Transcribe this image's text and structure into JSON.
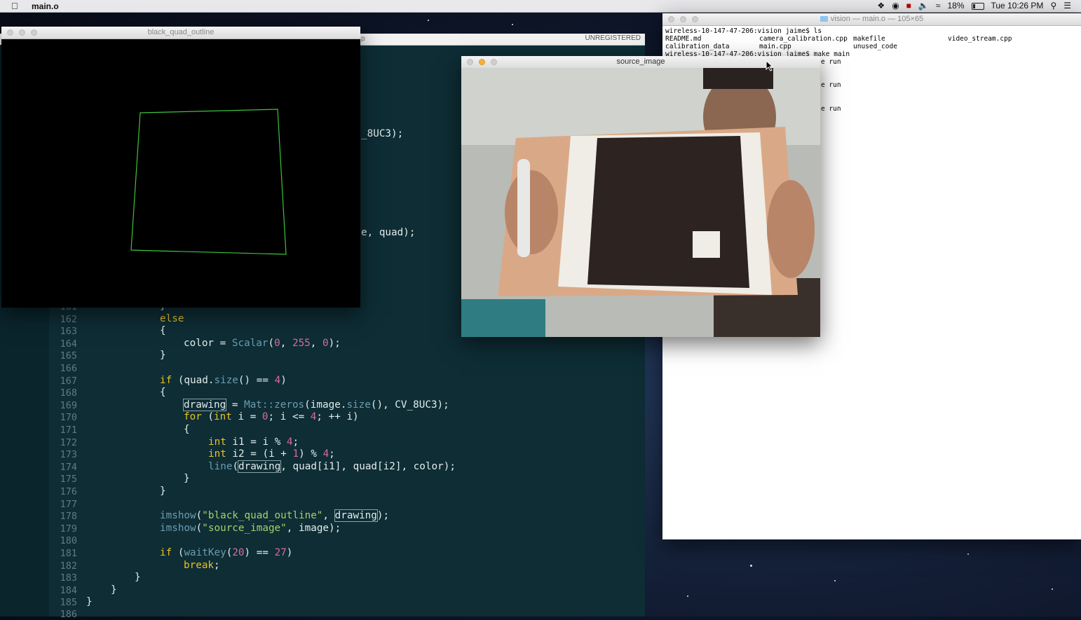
{
  "menubar": {
    "app_name": "main.o",
    "battery": "18%",
    "clock": "Tue 10:26 PM"
  },
  "editor": {
    "unregistered": "UNREGISTERED",
    "tab_fragment": "p",
    "partial_lines": {
      "line_a": "_8UC3);",
      "line_b": "e, quad);",
      "line_161": "161"
    },
    "lines": [
      {
        "n": "162"
      },
      {
        "n": "163"
      },
      {
        "n": "164"
      },
      {
        "n": "165"
      },
      {
        "n": "166"
      },
      {
        "n": "167"
      },
      {
        "n": "168"
      },
      {
        "n": "169"
      },
      {
        "n": "170"
      },
      {
        "n": "171"
      },
      {
        "n": "172"
      },
      {
        "n": "173"
      },
      {
        "n": "174"
      },
      {
        "n": "175"
      },
      {
        "n": "176"
      },
      {
        "n": "177"
      },
      {
        "n": "178"
      },
      {
        "n": "179"
      },
      {
        "n": "180"
      },
      {
        "n": "181"
      },
      {
        "n": "182"
      },
      {
        "n": "183"
      },
      {
        "n": "184"
      },
      {
        "n": "185"
      },
      {
        "n": "186"
      }
    ],
    "code": {
      "c161": "}",
      "c162": "else",
      "c163": "{",
      "c164_a": "color = ",
      "c164_fn": "Scalar",
      "c164_b": "(",
      "c164_n1": "0",
      "c164_c": ", ",
      "c164_n2": "255",
      "c164_d": ", ",
      "c164_n3": "0",
      "c164_e": ");",
      "c165": "}",
      "c167_kw": "if",
      "c167_a": " (quad.",
      "c167_fn": "size",
      "c167_b": "() == ",
      "c167_n": "4",
      "c167_c": ")",
      "c168": "{",
      "c169_box": "drawing",
      "c169_a": " = ",
      "c169_fn": "Mat::zeros",
      "c169_b": "(image.",
      "c169_fn2": "size",
      "c169_c": "(), CV_8UC3);",
      "c170_kw": "for",
      "c170_a": " (",
      "c170_kw2": "int",
      "c170_b": " i = ",
      "c170_n": "0",
      "c170_c": "; i <= ",
      "c170_n2": "4",
      "c170_d": "; ++ i)",
      "c171": "{",
      "c172_kw": "int",
      "c172_a": " i1 = i % ",
      "c172_n": "4",
      "c172_b": ";",
      "c173_kw": "int",
      "c173_a": " i2 = (i + ",
      "c173_n": "1",
      "c173_b": ") % ",
      "c173_n2": "4",
      "c173_c": ";",
      "c174_fn": "line",
      "c174_a": "(",
      "c174_box": "drawing",
      "c174_b": ", quad[i1], quad[i2], color);",
      "c175": "}",
      "c176": "}",
      "c178_fn": "imshow",
      "c178_a": "(",
      "c178_s": "\"black_quad_outline\"",
      "c178_b": ", ",
      "c178_box": "drawing",
      "c178_c": ");",
      "c179_fn": "imshow",
      "c179_a": "(",
      "c179_s": "\"source_image\"",
      "c179_b": ", image);",
      "c181_kw": "if",
      "c181_a": " (",
      "c181_fn": "waitKey",
      "c181_b": "(",
      "c181_n": "20",
      "c181_c": ") == ",
      "c181_n2": "27",
      "c181_d": ")",
      "c182_kw": "break",
      "c182_a": ";",
      "c183": "}",
      "c184": "}",
      "c185": "}"
    }
  },
  "quad_window": {
    "title": "black_quad_outline",
    "outline_color": "#3cc43c"
  },
  "source_window": {
    "title": "source_image"
  },
  "terminal": {
    "title": "vision — main.o — 105×65",
    "lines": {
      "l1": "wireless-10-147-47-206:vision jaime$ ls",
      "l2a": "README.md",
      "l2b": "camera_calibration.cpp",
      "l2c": "makefile",
      "l2d": "video_stream.cpp",
      "l3a": "calibration_data",
      "l3b": "main.cpp",
      "l3c": "unused_code",
      "l4": "wireless-10-147-47-206:vision jaime$ make main",
      "run1": "e run",
      "run2": "e run",
      "run3": "e run"
    }
  }
}
